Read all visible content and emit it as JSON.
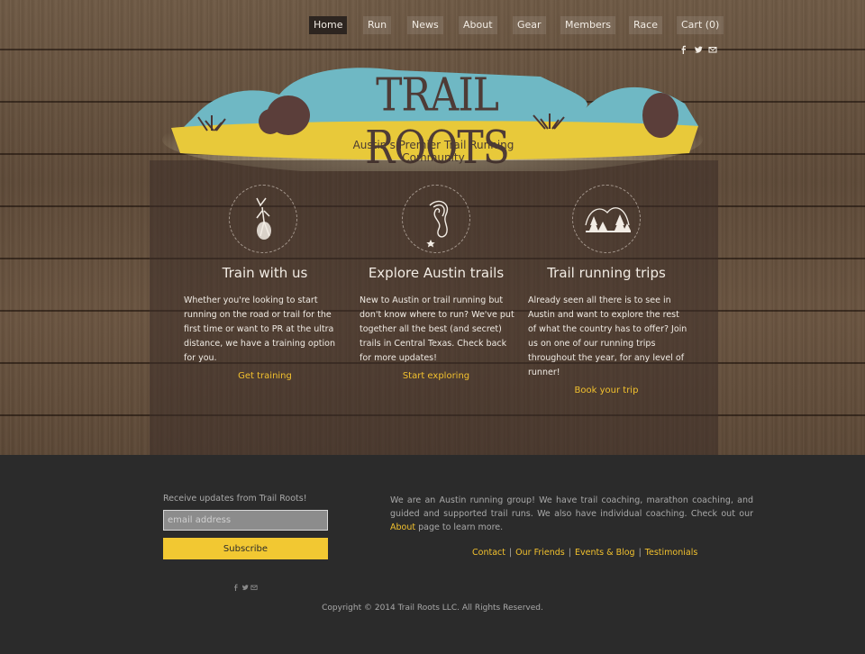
{
  "nav": {
    "items": [
      {
        "label": "Home"
      },
      {
        "label": "Run"
      },
      {
        "label": "News"
      },
      {
        "label": "About"
      },
      {
        "label": "Gear"
      },
      {
        "label": "Members"
      },
      {
        "label": "Race"
      },
      {
        "label": "Cart (0)"
      }
    ],
    "active": "Home"
  },
  "social": [
    "facebook-icon",
    "twitter-icon",
    "email-icon"
  ],
  "logo": {
    "title": "TRAIL ROOTS",
    "tagline": "Austin's Premier Trail Running Community"
  },
  "features": [
    {
      "icon": "runner-icon",
      "title": "Train with us",
      "text": "Whether you're looking to start running on the road or trail for the first time or want to PR at the ultra distance, we have a training option for you.",
      "link": "Get training"
    },
    {
      "icon": "trail-map-icon",
      "title": "Explore Austin trails",
      "text": "New to Austin or trail running but don't know where to run? We've put together all the best (and secret) trails in Central Texas.  Check back for more updates!",
      "link": "Start exploring"
    },
    {
      "icon": "mountain-trees-icon",
      "title": "Trail running trips",
      "text": "Already seen all there is to see in Austin and want to explore the rest of what the country has to offer?  Join us on one of our running trips throughout the year, for any level of runner!",
      "link": "Book your trip"
    }
  ],
  "footer": {
    "newsletter_label": "Receive updates from Trail Roots!",
    "email_placeholder": "email address",
    "subscribe_label": "Subscribe",
    "about_text_before": "We are an Austin running group! We have trail coaching, marathon coaching, and guided and supported trail runs. We also have individual coaching. Check out our ",
    "about_link": "About",
    "about_text_after": " page to learn more.",
    "links": [
      "Contact",
      "Our Friends",
      "Events & Blog",
      "Testimonials"
    ],
    "separator": "|",
    "copyright": "Copyright © 2014 Trail Roots LLC. All Rights Reserved."
  },
  "colors": {
    "accent": "#f2c12e",
    "sky": "#6fb8c4",
    "sand": "#e8c93a",
    "footer_bg": "#2b2b2b"
  }
}
